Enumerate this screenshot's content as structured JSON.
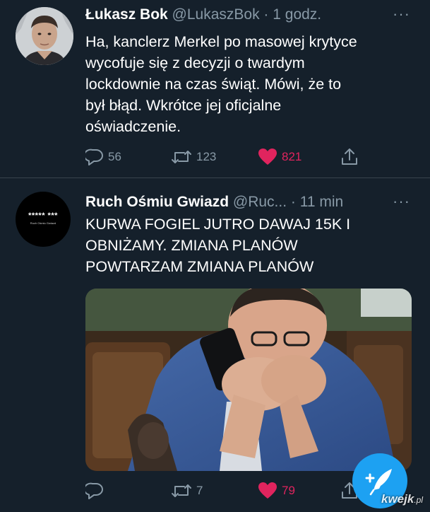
{
  "tweets": [
    {
      "author_name": "Łukasz Bok",
      "handle_time": "@LukaszBok · 1 godz.",
      "text": "Ha, kanclerz Merkel po masowej krytyce\nwycofuje się z decyzji o twardym\nlockdownie na czas świąt. Mówi, że to\nbył błąd. Wkrótce jej oficjalne\noświadczenie.",
      "more_label": "···",
      "replies": "56",
      "retweets": "123",
      "likes": "821",
      "liked": true
    },
    {
      "author_name": "Ruch Ośmiu Gwiazd",
      "handle_time": "@Ruc... · 11 min",
      "avatar_text": "***** ***",
      "avatar_subtext": "Ruch Ośmiu Gwiazd",
      "text": "KURWA FOGIEL JUTRO DAWAJ 15K I\nOBNIŻAMY. ZMIANA PLANÓW\nPOWTARZAM ZMIANA PLANÓW",
      "more_label": "···",
      "replies": "",
      "retweets": "7",
      "likes": "79",
      "liked": true
    }
  ],
  "compose_button": {
    "icon": "feather-plus-icon"
  },
  "watermark": {
    "brand": "kwejk",
    "suffix": ".pl"
  },
  "colors": {
    "background": "#15202b",
    "secondary_text": "#8899a6",
    "like": "#e0245e",
    "accent": "#1da1f2"
  }
}
